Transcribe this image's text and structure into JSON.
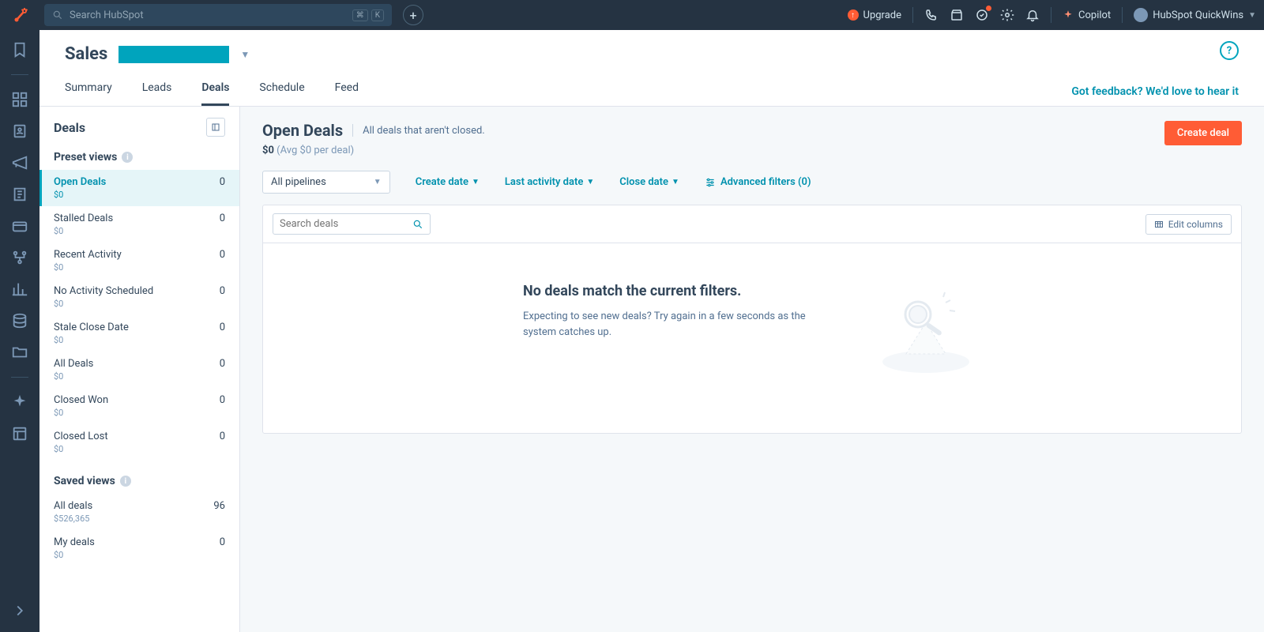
{
  "topbar": {
    "search_placeholder": "Search HubSpot",
    "kbd1": "⌘",
    "kbd2": "K",
    "upgrade": "Upgrade",
    "copilot": "Copilot",
    "account_name": "HubSpot QuickWins"
  },
  "page": {
    "title": "Sales",
    "feedback": "Got feedback? We'd love to hear it",
    "tabs": [
      "Summary",
      "Leads",
      "Deals",
      "Schedule",
      "Feed"
    ],
    "active_tab": "Deals"
  },
  "sidebar": {
    "header": "Deals",
    "preset_label": "Preset views",
    "saved_label": "Saved views",
    "preset": [
      {
        "name": "Open Deals",
        "count": "0",
        "sub": "$0",
        "active": true
      },
      {
        "name": "Stalled Deals",
        "count": "0",
        "sub": "$0"
      },
      {
        "name": "Recent Activity",
        "count": "0",
        "sub": "$0"
      },
      {
        "name": "No Activity Scheduled",
        "count": "0",
        "sub": "$0"
      },
      {
        "name": "Stale Close Date",
        "count": "0",
        "sub": "$0"
      },
      {
        "name": "All Deals",
        "count": "0",
        "sub": "$0"
      },
      {
        "name": "Closed Won",
        "count": "0",
        "sub": "$0"
      },
      {
        "name": "Closed Lost",
        "count": "0",
        "sub": "$0"
      }
    ],
    "saved": [
      {
        "name": "All deals",
        "count": "96",
        "sub": "$526,365"
      },
      {
        "name": "My deals",
        "count": "0",
        "sub": "$0"
      }
    ]
  },
  "content": {
    "title": "Open Deals",
    "desc": "All deals that aren't closed.",
    "total": "$0",
    "avg": "(Avg $0 per deal)",
    "create_btn": "Create deal",
    "pipeline": "All pipelines",
    "filters": {
      "create_date": "Create date",
      "last_activity": "Last activity date",
      "close_date": "Close date",
      "advanced": "Advanced filters (0)"
    },
    "search_placeholder": "Search deals",
    "edit_columns": "Edit columns",
    "empty_title": "No deals match the current filters.",
    "empty_body": "Expecting to see new deals? Try again in a few seconds as the system catches up."
  }
}
